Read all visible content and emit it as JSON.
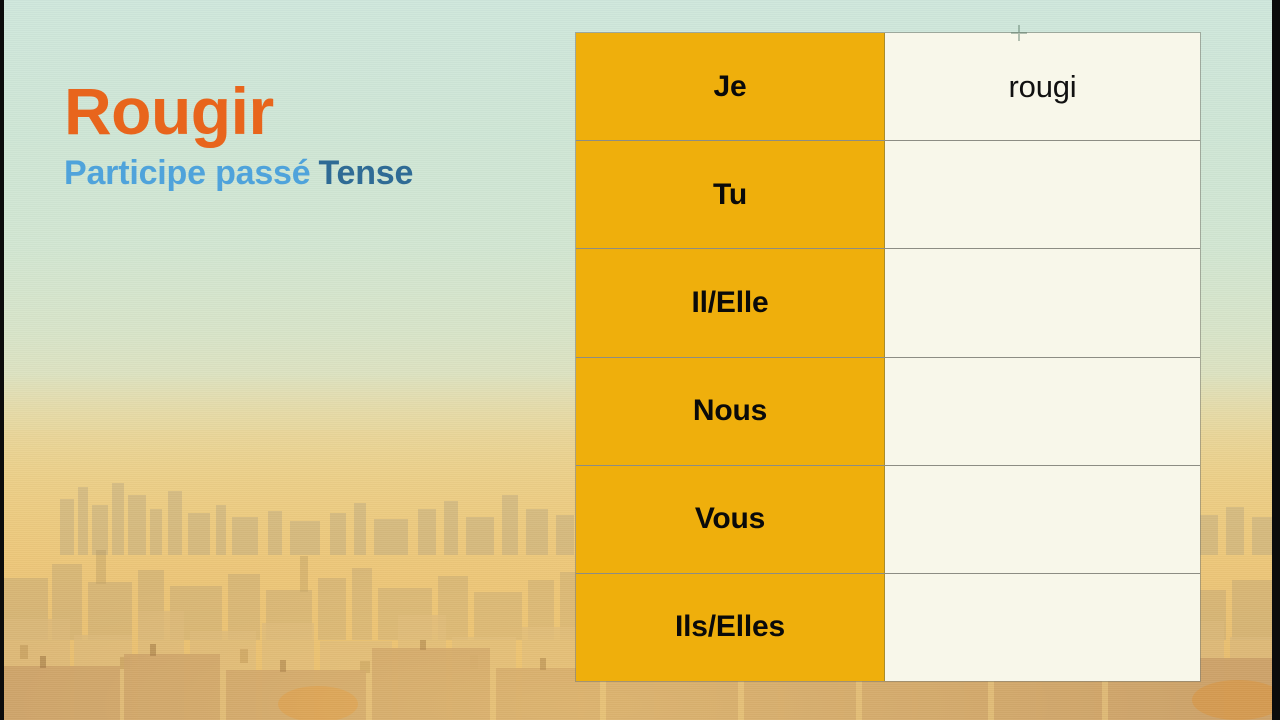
{
  "slide": {
    "verb": "Rougir",
    "tense_name": "Participe passé",
    "tense_word": "Tense",
    "colors": {
      "verb": "#E8651C",
      "tense_name": "#4FA3DB",
      "tense_word": "#2F6B95",
      "pronoun_cell": "#EFAF0C",
      "form_cell": "#F8F7EA",
      "cell_border": "#8D8D84",
      "background_sky": "#CFE7DC",
      "background_haze": "#E9D298"
    }
  },
  "background": {
    "scene": "paris-skyline-photo",
    "description": "Sepia-toned Paris cityscape under a pale mint-to-gold gradient sky"
  },
  "table": {
    "columns": [
      "pronoun",
      "conjugated_form"
    ],
    "rows": [
      {
        "pronoun": "Je",
        "form": "rougi"
      },
      {
        "pronoun": "Tu",
        "form": ""
      },
      {
        "pronoun": "Il/Elle",
        "form": ""
      },
      {
        "pronoun": "Nous",
        "form": ""
      },
      {
        "pronoun": "Vous",
        "form": ""
      },
      {
        "pronoun": "Ils/Elles",
        "form": ""
      }
    ]
  },
  "markers": {
    "plus_icon": "plus-icon"
  }
}
